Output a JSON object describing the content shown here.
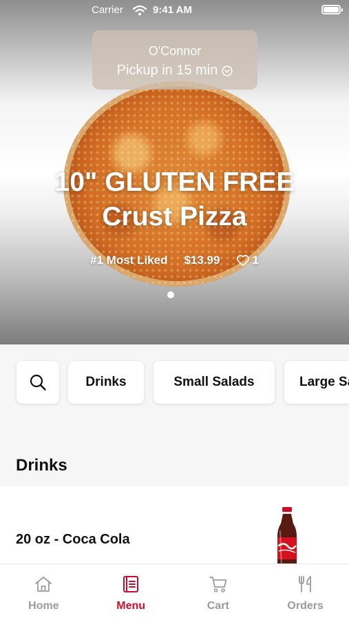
{
  "status_bar": {
    "carrier": "Carrier",
    "time": "9:41 AM"
  },
  "location": {
    "name": "O'Connor",
    "pickup": "Pickup in 15 min"
  },
  "hero": {
    "title_line1": "10\"  GLUTEN FREE",
    "title_line2": "Crust Pizza",
    "badge": "#1 Most Liked",
    "price": "$13.99",
    "likes": "1",
    "carousel_page": 1,
    "carousel_pages": 1
  },
  "categories": {
    "search_icon": "search-icon",
    "items": [
      "Drinks",
      "Small Salads",
      "Large Salads"
    ]
  },
  "section": {
    "title": "Drinks"
  },
  "menu_items": [
    {
      "name": "20 oz - Coca Cola",
      "image": "coca-cola-bottle"
    }
  ],
  "tab_bar": {
    "active_color": "#c8102e",
    "inactive_color": "#9b9b9b",
    "tabs": [
      {
        "label": "Home",
        "icon": "home-icon",
        "active": false
      },
      {
        "label": "Menu",
        "icon": "menu-icon",
        "active": true
      },
      {
        "label": "Cart",
        "icon": "cart-icon",
        "active": false
      },
      {
        "label": "Orders",
        "icon": "fork-knife-icon",
        "active": false
      }
    ]
  }
}
